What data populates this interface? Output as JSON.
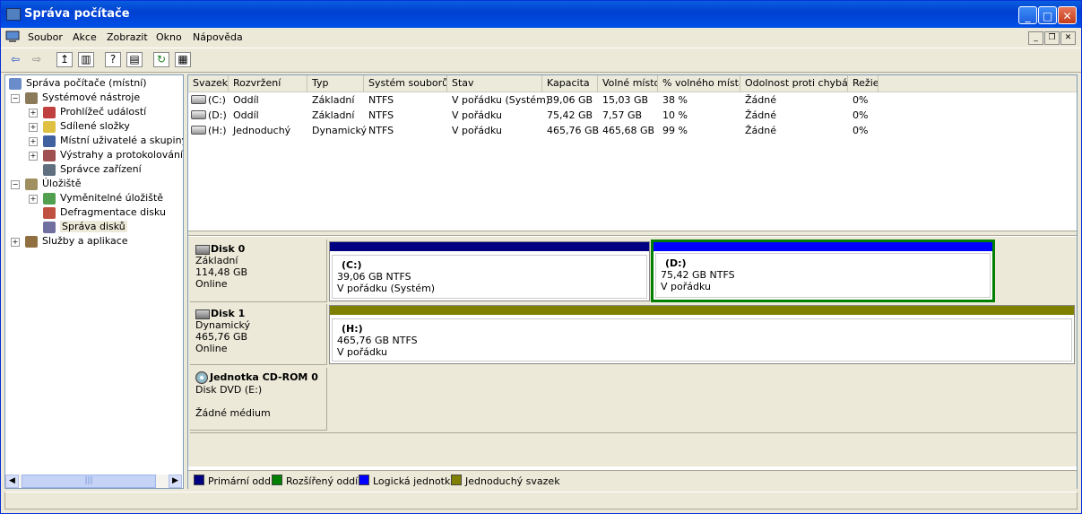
{
  "window": {
    "title": "Správa počítače"
  },
  "menu": [
    "Soubor",
    "Akce",
    "Zobrazit",
    "Okno",
    "Nápověda"
  ],
  "tree": [
    {
      "label": "Správa počítače (místní)",
      "level": 0,
      "expander": "",
      "icon": "computer-icon"
    },
    {
      "label": "Systémové nástroje",
      "level": 1,
      "expander": "−",
      "icon": "tools-icon"
    },
    {
      "label": "Prohlížeč událostí",
      "level": 2,
      "expander": "+",
      "icon": "event-viewer-icon"
    },
    {
      "label": "Sdílené složky",
      "level": 2,
      "expander": "+",
      "icon": "shared-folder-icon"
    },
    {
      "label": "Místní uživatelé a skupiny",
      "level": 2,
      "expander": "+",
      "icon": "users-icon"
    },
    {
      "label": "Výstrahy a protokolování vý",
      "level": 2,
      "expander": "+",
      "icon": "alerts-icon"
    },
    {
      "label": "Správce zařízení",
      "level": 2,
      "expander": "",
      "icon": "device-manager-icon"
    },
    {
      "label": "Úložiště",
      "level": 1,
      "expander": "−",
      "icon": "storage-icon"
    },
    {
      "label": "Vyměnitelné úložiště",
      "level": 2,
      "expander": "+",
      "icon": "removable-storage-icon"
    },
    {
      "label": "Defragmentace disku",
      "level": 2,
      "expander": "",
      "icon": "defrag-icon"
    },
    {
      "label": "Správa disků",
      "level": 2,
      "expander": "",
      "icon": "disk-management-icon"
    },
    {
      "label": "Služby a aplikace",
      "level": 1,
      "expander": "+",
      "icon": "services-icon"
    }
  ],
  "volume_list": {
    "columns": [
      "Svazek",
      "Rozvržení",
      "Typ",
      "Systém souborů",
      "Stav",
      "Kapacita",
      "Volné místo",
      "% volného místa",
      "Odolnost proti chybám",
      "Režie"
    ],
    "rows": [
      [
        "(C:)",
        "Oddíl",
        "Základní",
        "NTFS",
        "V pořádku (Systém)",
        "39,06 GB",
        "15,03 GB",
        "38 %",
        "Žádné",
        "0%"
      ],
      [
        "(D:)",
        "Oddíl",
        "Základní",
        "NTFS",
        "V pořádku",
        "75,42 GB",
        "7,57 GB",
        "10 %",
        "Žádné",
        "0%"
      ],
      [
        "(H:)",
        "Jednoduchý",
        "Dynamický",
        "NTFS",
        "V pořádku",
        "465,76 GB",
        "465,68 GB",
        "99 %",
        "Žádné",
        "0%"
      ]
    ]
  },
  "disks": {
    "disk0": {
      "name": "Disk 0",
      "type": "Základní",
      "size": "114,48 GB",
      "status": "Online",
      "partitions": [
        {
          "name": "(C:)",
          "size": "39,06 GB NTFS",
          "status": "V pořádku (Systém)",
          "color": "#000080"
        },
        {
          "name": "(D:)",
          "size": "75,42 GB NTFS",
          "status": "V pořádku",
          "color": "#0000FF"
        }
      ]
    },
    "disk1": {
      "name": "Disk 1",
      "type": "Dynamický",
      "size": "465,76 GB",
      "status": "Online",
      "partitions": [
        {
          "name": "(H:)",
          "size": "465,76 GB NTFS",
          "status": "V pořádku",
          "color": "#808000"
        }
      ]
    },
    "cdrom0": {
      "name": "Jednotka CD-ROM 0",
      "type": "Disk DVD (E:)",
      "status": "Žádné médium"
    }
  },
  "legend": [
    {
      "label": "Primární oddíl",
      "color": "#000080"
    },
    {
      "label": "Rozšířený oddíl",
      "color": "#008000"
    },
    {
      "label": "Logická jednotka",
      "color": "#0000FF"
    },
    {
      "label": "Jednoduchý svazek",
      "color": "#808000"
    }
  ],
  "selected_border_color": "#008000"
}
